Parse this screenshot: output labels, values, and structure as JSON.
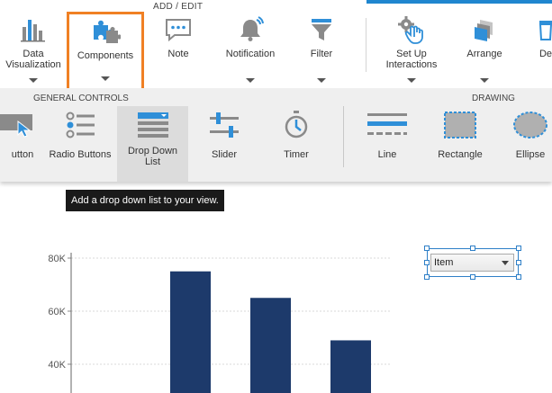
{
  "ribbon": {
    "section_title": "ADD / EDIT",
    "buttons": [
      {
        "id": "data-visualization",
        "label": "Data\nVisualization",
        "icon": "bar-chart-icon"
      },
      {
        "id": "components",
        "label": "Components",
        "icon": "puzzle-icon",
        "selected": true
      },
      {
        "id": "note",
        "label": "Note",
        "icon": "speech-bubble-icon"
      },
      {
        "id": "notification",
        "label": "Notification",
        "icon": "bell-icon"
      },
      {
        "id": "filter",
        "label": "Filter",
        "icon": "funnel-icon"
      },
      {
        "id": "set-up-interactions",
        "label": "Set Up\nInteractions",
        "icon": "gear-hand-icon"
      },
      {
        "id": "arrange",
        "label": "Arrange",
        "icon": "layers-icon"
      },
      {
        "id": "de",
        "label": "De",
        "icon": "trash-icon"
      }
    ]
  },
  "gallery": {
    "sections": {
      "general": "GENERAL CONTROLS",
      "drawing": "DRAWING"
    },
    "items": [
      {
        "id": "button",
        "label": "utton",
        "icon": "button-icon"
      },
      {
        "id": "radio-buttons",
        "label": "Radio Buttons",
        "icon": "radio-list-icon"
      },
      {
        "id": "drop-down-list",
        "label": "Drop Down\nList",
        "icon": "dropdown-list-icon",
        "hover": true
      },
      {
        "id": "slider",
        "label": "Slider",
        "icon": "slider-icon"
      },
      {
        "id": "timer",
        "label": "Timer",
        "icon": "stopwatch-icon"
      },
      {
        "id": "line",
        "label": "Line",
        "icon": "line-icon"
      },
      {
        "id": "rectangle",
        "label": "Rectangle",
        "icon": "rectangle-icon"
      },
      {
        "id": "ellipse",
        "label": "Ellipse",
        "icon": "ellipse-icon"
      }
    ]
  },
  "tooltip": "Add a drop down list to your view.",
  "dropdown": {
    "value": "Item"
  },
  "colors": {
    "accent": "#1f86cf",
    "selected_border": "#f08024",
    "bar": "#1d3a6b",
    "icon_blue": "#2f8fd8",
    "icon_gray": "#8a8a8a"
  },
  "chart_data": {
    "type": "bar",
    "y_ticks": [
      "80K",
      "60K",
      "40K"
    ],
    "ylim": [
      35000,
      80000
    ],
    "values": [
      75000,
      65000,
      49000
    ],
    "grid": true
  }
}
